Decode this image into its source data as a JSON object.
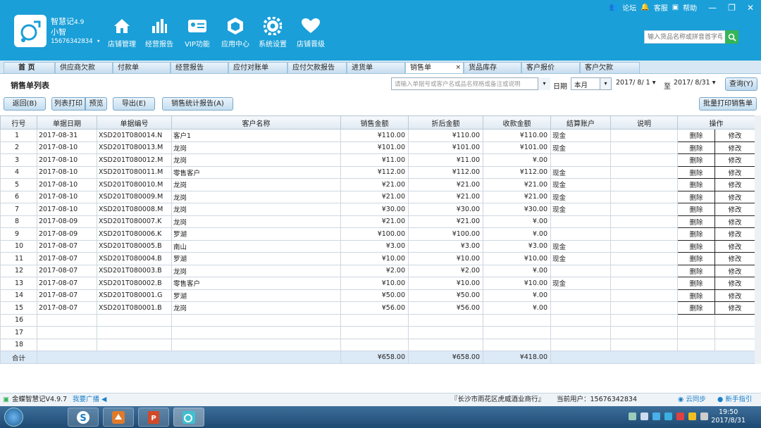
{
  "app": {
    "name": "智慧记",
    "version": "4.9",
    "user": "小智",
    "phone": "15676342834"
  },
  "nav": [
    "店铺管理",
    "经营报告",
    "VIP功能",
    "应用中心",
    "系统设置",
    "店铺晋级"
  ],
  "sys": {
    "forum": "论坛",
    "service": "客服",
    "help": "帮助"
  },
  "search_placeholder": "输入货品名称或拼音首字母",
  "tabs": [
    "首 页",
    "供应商欠款",
    "付款单",
    "经营报告",
    "应付对账单",
    "应付欠款报告",
    "进货单",
    "销售单",
    "货品库存",
    "客户报价",
    "客户欠款"
  ],
  "page_title": "销售单列表",
  "filter": {
    "placeholder": "请输入单据号或客户名或品名规格或备注或说明",
    "date_label": "日期",
    "period": "本月",
    "from": "2017/ 8/ 1",
    "to_label": "至",
    "to": "2017/ 8/31",
    "query": "查询(Y)"
  },
  "actions": {
    "back": "返回(B)",
    "print_list": "列表打印",
    "preview": "预览",
    "export": "导出(E)",
    "stats": "销售统计报告(A)",
    "batch_print": "批量打印销售单"
  },
  "columns": [
    "行号",
    "单据日期",
    "单据编号",
    "客户名称",
    "销售金额",
    "折后金额",
    "收款金额",
    "结算账户",
    "说明",
    "操作"
  ],
  "op_labels": {
    "delete": "删除",
    "edit": "修改"
  },
  "rows": [
    {
      "no": "1",
      "date": "2017-08-31",
      "code": "XSD201T080014.N",
      "customer": "客户1",
      "amount": "¥110.00",
      "discount": "¥110.00",
      "received": "¥110.00",
      "account": "现金",
      "note": ""
    },
    {
      "no": "2",
      "date": "2017-08-10",
      "code": "XSD201T080013.M",
      "customer": "龙岗",
      "amount": "¥101.00",
      "discount": "¥101.00",
      "received": "¥101.00",
      "account": "现金",
      "note": ""
    },
    {
      "no": "3",
      "date": "2017-08-10",
      "code": "XSD201T080012.M",
      "customer": "龙岗",
      "amount": "¥11.00",
      "discount": "¥11.00",
      "received": "¥.00",
      "account": "",
      "note": ""
    },
    {
      "no": "4",
      "date": "2017-08-10",
      "code": "XSD201T080011.M",
      "customer": "零售客户",
      "amount": "¥112.00",
      "discount": "¥112.00",
      "received": "¥112.00",
      "account": "现金",
      "note": ""
    },
    {
      "no": "5",
      "date": "2017-08-10",
      "code": "XSD201T080010.M",
      "customer": "龙岗",
      "amount": "¥21.00",
      "discount": "¥21.00",
      "received": "¥21.00",
      "account": "现金",
      "note": ""
    },
    {
      "no": "6",
      "date": "2017-08-10",
      "code": "XSD201T080009.M",
      "customer": "龙岗",
      "amount": "¥21.00",
      "discount": "¥21.00",
      "received": "¥21.00",
      "account": "现金",
      "note": ""
    },
    {
      "no": "7",
      "date": "2017-08-10",
      "code": "XSD201T080008.M",
      "customer": "龙岗",
      "amount": "¥30.00",
      "discount": "¥30.00",
      "received": "¥30.00",
      "account": "现金",
      "note": ""
    },
    {
      "no": "8",
      "date": "2017-08-09",
      "code": "XSD201T080007.K",
      "customer": "龙岗",
      "amount": "¥21.00",
      "discount": "¥21.00",
      "received": "¥.00",
      "account": "",
      "note": ""
    },
    {
      "no": "9",
      "date": "2017-08-09",
      "code": "XSD201T080006.K",
      "customer": "罗湖",
      "amount": "¥100.00",
      "discount": "¥100.00",
      "received": "¥.00",
      "account": "",
      "note": ""
    },
    {
      "no": "10",
      "date": "2017-08-07",
      "code": "XSD201T080005.B",
      "customer": "南山",
      "amount": "¥3.00",
      "discount": "¥3.00",
      "received": "¥3.00",
      "account": "现金",
      "note": ""
    },
    {
      "no": "11",
      "date": "2017-08-07",
      "code": "XSD201T080004.B",
      "customer": "罗湖",
      "amount": "¥10.00",
      "discount": "¥10.00",
      "received": "¥10.00",
      "account": "现金",
      "note": ""
    },
    {
      "no": "12",
      "date": "2017-08-07",
      "code": "XSD201T080003.B",
      "customer": "龙岗",
      "amount": "¥2.00",
      "discount": "¥2.00",
      "received": "¥.00",
      "account": "",
      "note": ""
    },
    {
      "no": "13",
      "date": "2017-08-07",
      "code": "XSD201T080002.B",
      "customer": "零售客户",
      "amount": "¥10.00",
      "discount": "¥10.00",
      "received": "¥10.00",
      "account": "现金",
      "note": ""
    },
    {
      "no": "14",
      "date": "2017-08-07",
      "code": "XSD201T080001.G",
      "customer": "罗湖",
      "amount": "¥50.00",
      "discount": "¥50.00",
      "received": "¥.00",
      "account": "",
      "note": ""
    },
    {
      "no": "15",
      "date": "2017-08-07",
      "code": "XSD201T080001.B",
      "customer": "龙岗",
      "amount": "¥56.00",
      "discount": "¥56.00",
      "received": "¥.00",
      "account": "",
      "note": ""
    }
  ],
  "empty_rows": [
    "16",
    "17",
    "18"
  ],
  "total": {
    "label": "合计",
    "amount": "¥658.00",
    "discount": "¥658.00",
    "received": "¥418.00"
  },
  "status": {
    "app": "金蝶智慧记V4.9.7",
    "broadcast": "我要广播",
    "shop": "『长沙市雨花区虎威酒业商行』",
    "current_user": "当前用户：15676342834",
    "cloud": "云同步",
    "guide": "新手指引"
  },
  "clock": {
    "time": "19:50",
    "date": "2017/8/31"
  },
  "colors": {
    "header": "#1a9fd8",
    "total_row": "#dce9f6",
    "search_button": "#35b558"
  }
}
